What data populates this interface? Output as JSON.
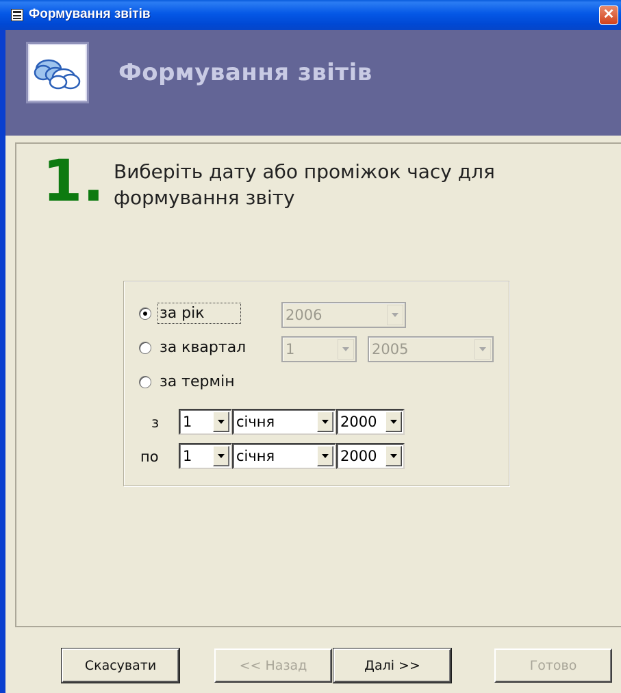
{
  "window": {
    "title": "Формування звітів",
    "close_glyph": "✕",
    "icon": "form-window-icon"
  },
  "header": {
    "title": "Формування звітів",
    "logo_icon": "clouds-icon"
  },
  "step": {
    "number": "1.",
    "instruction": "Виберіть дату або проміжок часу для формування звіту"
  },
  "options": {
    "year": {
      "label": "за рік",
      "selected": true,
      "value": "2006"
    },
    "quarter": {
      "label": "за квартал",
      "selected": false,
      "quarter_value": "1",
      "year_value": "2005"
    },
    "term": {
      "label": "за термін",
      "selected": false,
      "from": {
        "label": "з",
        "day": "1",
        "month": "січня",
        "year": "2000"
      },
      "to": {
        "label": "по",
        "day": "1",
        "month": "січня",
        "year": "2000"
      }
    }
  },
  "buttons": {
    "cancel": "Скасувати",
    "back": "<< Назад",
    "next": "Далі >>",
    "finish": "Готово"
  },
  "colors": {
    "header_band": "#636596",
    "step_number": "#0d7a10",
    "titlebar": "#0558e6"
  }
}
